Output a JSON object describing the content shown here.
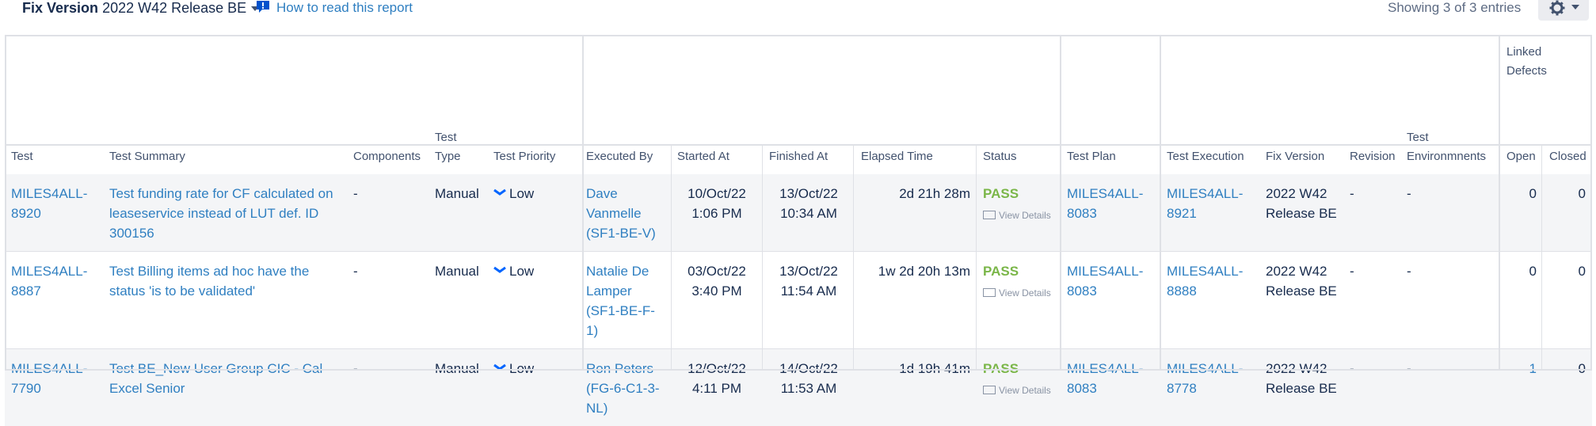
{
  "toolbar": {
    "fix_version_label": "Fix Version",
    "fix_version_value": "2022 W42 Release BE",
    "help_link": "How to read this report",
    "showing": "Showing 3 of 3 entries"
  },
  "columns": {
    "test": "Test",
    "test_summary": "Test Summary",
    "components": "Components",
    "test_type_top": "Test",
    "test_type_bottom": "Type",
    "test_priority": "Test Priority",
    "executed_by": "Executed By",
    "started_at": "Started At",
    "finished_at": "Finished At",
    "elapsed_time": "Elapsed Time",
    "status": "Status",
    "test_plan": "Test Plan",
    "test_execution": "Test Execution",
    "fix_version": "Fix Version",
    "revision": "Revision",
    "test_env_top": "Test",
    "test_env_bottom": "Environmnents",
    "linked_defects_top": "Linked",
    "linked_defects_bottom": "Defects",
    "open": "Open",
    "closed": "Closed"
  },
  "rows": [
    {
      "test": "MILES4ALL-8920",
      "summary": "Test funding rate for CF calculated on leaseservice instead of LUT def. ID 300156",
      "components": "-",
      "type": "Manual",
      "priority": "Low",
      "executed_by": "Dave Vanmelle (SF1-BE-V)",
      "started_date": "10/Oct/22",
      "started_time": "1:06 PM",
      "finished_date": "13/Oct/22",
      "finished_time": "10:34 AM",
      "elapsed": "2d 21h 28m",
      "status": "PASS",
      "view_details": "View Details",
      "test_plan": "MILES4ALL-8083",
      "test_execution": "MILES4ALL-8921",
      "fix_version": "2022 W42 Release BE",
      "revision": "-",
      "environments": "-",
      "open": "0",
      "closed": "0"
    },
    {
      "test": "MILES4ALL-8887",
      "summary": "Test Billing items ad hoc have the status 'is to be validated'",
      "components": "-",
      "type": "Manual",
      "priority": "Low",
      "executed_by": "Natalie De Lamper (SF1-BE-F-1)",
      "started_date": "03/Oct/22",
      "started_time": "3:40 PM",
      "finished_date": "13/Oct/22",
      "finished_time": "11:54 AM",
      "elapsed": "1w 2d 20h 13m",
      "status": "PASS",
      "view_details": "View Details",
      "test_plan": "MILES4ALL-8083",
      "test_execution": "MILES4ALL-8888",
      "fix_version": "2022 W42 Release BE",
      "revision": "-",
      "environments": "-",
      "open": "0",
      "closed": "0"
    },
    {
      "test": "MILES4ALL-7790",
      "summary": "Test BE_New User Group CIC - Cal Excel Senior",
      "components": "-",
      "type": "Manual",
      "priority": "Low",
      "executed_by": "Ron Peters (FG-6-C1-3-NL)",
      "started_date": "12/Oct/22",
      "started_time": "4:11 PM",
      "finished_date": "14/Oct/22",
      "finished_time": "11:53 AM",
      "elapsed": "1d 19h 41m",
      "status": "PASS",
      "view_details": "View Details",
      "test_plan": "MILES4ALL-8083",
      "test_execution": "MILES4ALL-8778",
      "fix_version": "2022 W42 Release BE",
      "revision": "-",
      "environments": "-",
      "open": "1",
      "closed": "0"
    }
  ],
  "colors": {
    "link": "#2f7fc1",
    "pass": "#7ab648",
    "stripe": "#f4f5f7",
    "border": "#dfe1e6"
  },
  "icons": {
    "help": "help-speech-icon",
    "gear": "gear-icon",
    "priority_low": "chevron-down-icon",
    "view_details": "details-icon"
  }
}
